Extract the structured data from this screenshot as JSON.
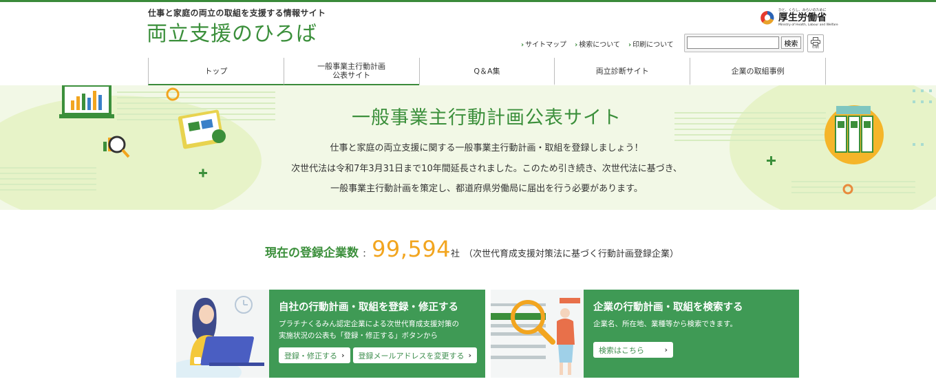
{
  "header": {
    "tagline": "仕事と家庭の両立の取組を支援する情報サイト",
    "site_name": "両立支援のひろば",
    "ministry": {
      "small": "ひと、くらし、みらいのために",
      "name": "厚生労働省",
      "english": "Ministry of Health, Labour and Welfare"
    },
    "links": [
      "サイトマップ",
      "検索について",
      "印刷について"
    ],
    "search": {
      "placeholder": "",
      "button": "検索"
    },
    "print_label": "印刷"
  },
  "nav": [
    {
      "label": "トップ"
    },
    {
      "label": "一般事業主行動計画\n公表サイト"
    },
    {
      "label": "Q＆A集"
    },
    {
      "label": "両立診断サイト"
    },
    {
      "label": "企業の取組事例"
    }
  ],
  "hero": {
    "title": "一般事業主行動計画公表サイト",
    "lines": [
      "仕事と家庭の両立支援に関する一般事業主行動計画・取組を登録しましょう！",
      "次世代法は令和7年3月31日まで10年間延長されました。このため引き続き、次世代法に基づき、",
      "一般事業主行動計画を策定し、都道府県労働局に届出を行う必要があります。"
    ]
  },
  "count": {
    "label": "現在の登録企業数",
    "colon": ":",
    "number": "99,594",
    "unit": "社",
    "note": "（次世代育成支援対策法に基づく行動計画登録企業）"
  },
  "cards": [
    {
      "title": "自社の行動計画・取組を登録・修正する",
      "text": "プラチナくるみん認定企業による次世代育成支援対策の\n実施状況の公表も「登録・修正する」ボタンから",
      "buttons": [
        "登録・修正する",
        "登録メールアドレスを変更する"
      ]
    },
    {
      "title": "企業の行動計画・取組を検索する",
      "text": "企業名、所在地、業種等から検索できます。",
      "buttons": [
        "検索はこちら"
      ]
    }
  ],
  "colors": {
    "brand_green": "#3b8f3b",
    "card_green": "#3f9a55",
    "accent_orange": "#f2a51f",
    "hero_bg": "#f2f8e6"
  }
}
